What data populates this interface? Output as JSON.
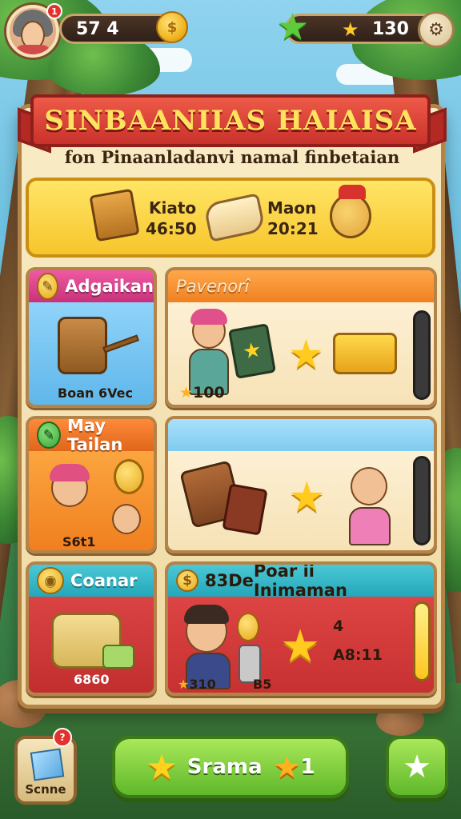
{
  "hud": {
    "notification_count": "1",
    "coins": "57 4",
    "stars": "130"
  },
  "title": {
    "main": "SINBAANIIAS HAIAISA",
    "subtitle": "fon Pinaanladanvi namal finbetaian"
  },
  "banner": {
    "left_label": "Kiato",
    "left_value": "46:50",
    "right_label": "Maon",
    "right_value": "20:21"
  },
  "cards": [
    {
      "title": "Adgaikan",
      "footer": "Boan 6Vec",
      "color": "#e2438d"
    },
    {
      "title": "Pavenorî",
      "value": "100",
      "color": "#f08a2c"
    },
    {
      "title": "May Tailan",
      "footer": "S6t1",
      "color": "#f07a22"
    },
    {
      "title": "",
      "color": "#8fd4f2"
    },
    {
      "title": "Coanar",
      "value": "6860",
      "color": "#2bb3c6"
    },
    {
      "title": "Poar ii Inimaman",
      "badge": "83De",
      "value_a": "310",
      "value_b": "B5",
      "mark": "4",
      "timer": "A8:11",
      "color": "#2bb3c6"
    }
  ],
  "bottom": {
    "box_label": "Scnne",
    "box_notif": "?",
    "play_label": "Srama",
    "play_count": "1"
  }
}
